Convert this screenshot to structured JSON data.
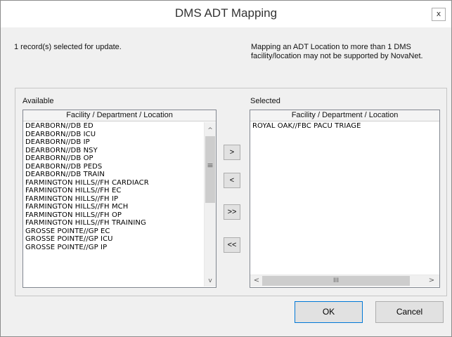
{
  "window": {
    "title": "DMS ADT Mapping",
    "close_label": "x"
  },
  "info": {
    "selected_count_text": "1 record(s) selected for update.",
    "warning_text": "Mapping an ADT Location to more than 1 DMS facility/location may not be supported by NovaNet."
  },
  "available": {
    "label": "Available",
    "column_header": "Facility / Department / Location",
    "items": [
      "DEARBORN//DB ED",
      "DEARBORN//DB ICU",
      "DEARBORN//DB IP",
      "DEARBORN//DB NSY",
      "DEARBORN//DB OP",
      "DEARBORN//DB PEDS",
      "DEARBORN//DB TRAIN",
      "FARMINGTON HILLS//FH CARDIACR",
      "FARMINGTON HILLS//FH EC",
      "FARMINGTON HILLS//FH IP",
      "FARMINGTON HILLS//FH MCH",
      "FARMINGTON HILLS//FH OP",
      "FARMINGTON HILLS//FH TRAINING",
      "GROSSE POINTE//GP EC",
      "GROSSE POINTE//GP ICU",
      "GROSSE POINTE//GP IP"
    ]
  },
  "selected": {
    "label": "Selected",
    "column_header": "Facility / Department / Location",
    "items": [
      "ROYAL OAK//FBC PACU TRIAGE"
    ]
  },
  "move_buttons": {
    "add": ">",
    "remove": "<",
    "add_all": ">>",
    "remove_all": "<<"
  },
  "scrollbar_glyphs": {
    "up": "^",
    "down": "v",
    "left": "<",
    "right": ">",
    "v_grip": "≡",
    "h_grip": "III"
  },
  "footer": {
    "ok_label": "OK",
    "cancel_label": "Cancel"
  }
}
